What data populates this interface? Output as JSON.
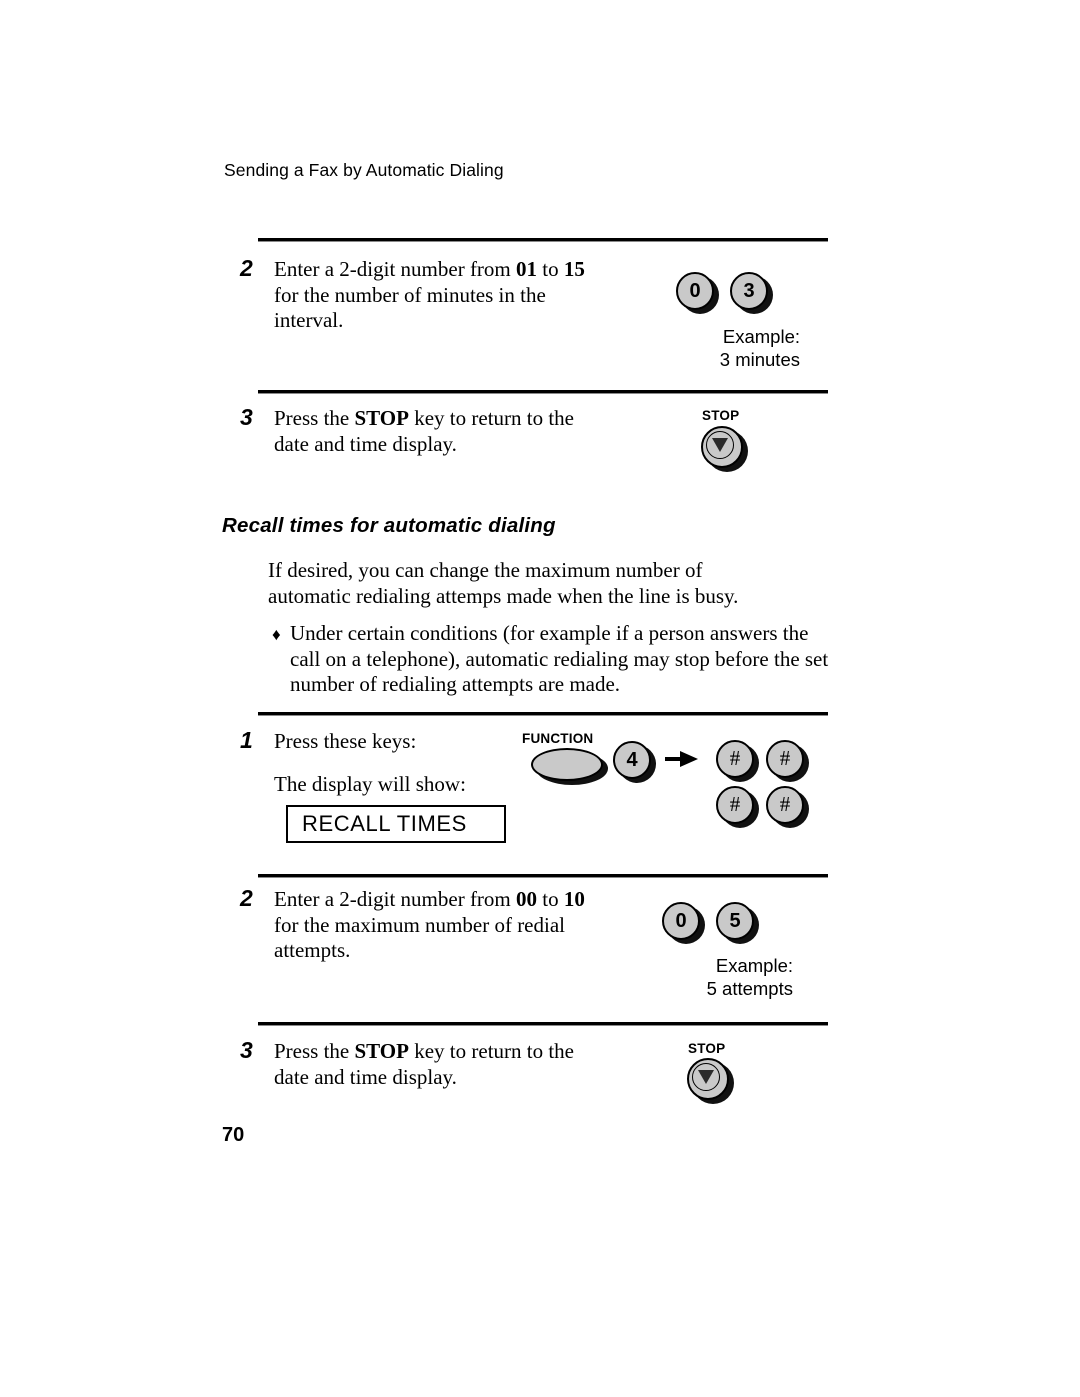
{
  "document": {
    "running_header": "Sending a Fax by Automatic Dialing",
    "page_number": "70"
  },
  "section_top": {
    "steps": [
      {
        "number": "2",
        "text_parts": [
          {
            "t": "Enter a 2-digit number from ",
            "bold": false
          },
          {
            "t": "01",
            "bold": true
          },
          {
            "t": " to ",
            "bold": false
          },
          {
            "t": "15",
            "bold": true
          },
          {
            "t": " for the number of minutes in the interval.",
            "bold": false
          }
        ],
        "keys": [
          "0",
          "3"
        ],
        "example_caption": "Example:\n3 minutes"
      },
      {
        "number": "3",
        "text_parts": [
          {
            "t": "Press the ",
            "bold": false
          },
          {
            "t": "STOP",
            "bold": true
          },
          {
            "t": " key to return to the date and time display.",
            "bold": false
          }
        ],
        "stop_key_label": "STOP"
      }
    ]
  },
  "recall_section": {
    "heading": "Recall times for automatic dialing",
    "intro": "If desired, you can change the maximum number of automatic redialing attemps made when the line is busy.",
    "bullet_mark": "♦",
    "bullet": "Under certain conditions (for example if a person answers the call on a telephone), automatic redialing may stop before the set number of redialing attempts are made.",
    "steps": [
      {
        "number": "1",
        "label_press": "Press these keys:",
        "label_display": "The display will show:",
        "display_text": "RECALL TIMES",
        "function_key_label": "FUNCTION",
        "digit_key": "4",
        "arrow": "arrow-right",
        "hash_keys": [
          "#",
          "#",
          "#",
          "#"
        ]
      },
      {
        "number": "2",
        "text_parts": [
          {
            "t": "Enter a 2-digit number from ",
            "bold": false
          },
          {
            "t": "00",
            "bold": true
          },
          {
            "t": " to ",
            "bold": false
          },
          {
            "t": "10",
            "bold": true
          },
          {
            "t": " for the maximum number of redial attempts.",
            "bold": false
          }
        ],
        "keys": [
          "0",
          "5"
        ],
        "example_caption": "Example:\n5 attempts"
      },
      {
        "number": "3",
        "text_parts": [
          {
            "t": "Press the ",
            "bold": false
          },
          {
            "t": "STOP",
            "bold": true
          },
          {
            "t": " key to return to the date and time display.",
            "bold": false
          }
        ],
        "stop_key_label": "STOP"
      }
    ]
  },
  "colors": {
    "key_face": "#c9c9c9",
    "key_shadow": "#111111",
    "ink": "#000000",
    "paper": "#ffffff"
  }
}
